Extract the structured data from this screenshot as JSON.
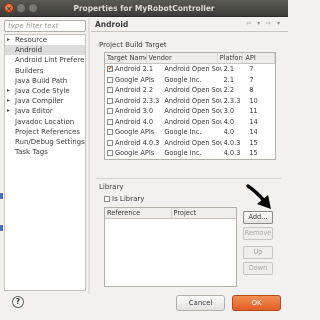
{
  "window": {
    "title": "Properties for MyRobotController"
  },
  "filter": {
    "placeholder": "type filter text"
  },
  "nav": {
    "items": [
      {
        "label": "Resource",
        "arrow": "▸"
      },
      {
        "label": "Android",
        "arrow": ""
      },
      {
        "label": "Android Lint Preferences",
        "arrow": ""
      },
      {
        "label": "Builders",
        "arrow": ""
      },
      {
        "label": "Java Build Path",
        "arrow": ""
      },
      {
        "label": "Java Code Style",
        "arrow": "▸"
      },
      {
        "label": "Java Compiler",
        "arrow": "▸"
      },
      {
        "label": "Java Editor",
        "arrow": "▸"
      },
      {
        "label": "Javadoc Location",
        "arrow": ""
      },
      {
        "label": "Project References",
        "arrow": ""
      },
      {
        "label": "Run/Debug Settings",
        "arrow": ""
      },
      {
        "label": "Task Tags",
        "arrow": ""
      }
    ]
  },
  "page": {
    "title": "Android",
    "nav_arrows": "⇦ ▾ ⇨ ▾"
  },
  "build_target": {
    "group_label": "Project Build Target",
    "columns": [
      "Target Name",
      "Vendor",
      "Platform",
      "API"
    ],
    "rows": [
      {
        "name": "Android 2.1",
        "vendor": "Android Open Source Project",
        "platform": "2.1",
        "api": "7",
        "checked": true
      },
      {
        "name": "Google APIs",
        "vendor": "Google Inc.",
        "platform": "2.1",
        "api": "7",
        "checked": false
      },
      {
        "name": "Android 2.2",
        "vendor": "Android Open Source Project",
        "platform": "2.2",
        "api": "8",
        "checked": false
      },
      {
        "name": "Android 2.3.3",
        "vendor": "Android Open Source Project",
        "platform": "2.3.3",
        "api": "10",
        "checked": false
      },
      {
        "name": "Android 3.0",
        "vendor": "Android Open Source Project",
        "platform": "3.0",
        "api": "11",
        "checked": false
      },
      {
        "name": "Android 4.0",
        "vendor": "Android Open Source Project",
        "platform": "4.0",
        "api": "14",
        "checked": false
      },
      {
        "name": "Google APIs",
        "vendor": "Google Inc.",
        "platform": "4.0",
        "api": "14",
        "checked": false
      },
      {
        "name": "Android 4.0.3",
        "vendor": "Android Open Source Project",
        "platform": "4.0.3",
        "api": "15",
        "checked": false
      },
      {
        "name": "Google APIs",
        "vendor": "Google Inc.",
        "platform": "4.0.3",
        "api": "15",
        "checked": false
      }
    ]
  },
  "library": {
    "group_label": "Library",
    "is_library_label": "Is Library",
    "columns": [
      "Reference",
      "Project"
    ],
    "buttons": {
      "add": "Add...",
      "remove": "Remove",
      "up": "Up",
      "down": "Down"
    }
  },
  "footer": {
    "help": "?",
    "cancel": "Cancel",
    "ok": "OK"
  },
  "colors": {
    "accent": "#e35f24",
    "title_bar": "#3c3b37",
    "selection": "#dcdcdc"
  }
}
